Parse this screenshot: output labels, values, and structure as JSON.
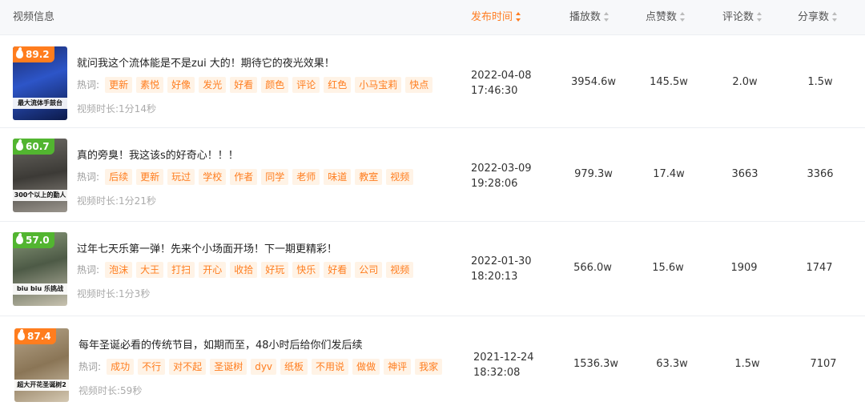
{
  "header": {
    "video_info": "视频信息",
    "publish_time": "发布时间",
    "plays": "播放数",
    "likes": "点赞数",
    "comments": "评论数",
    "shares": "分享数"
  },
  "labels": {
    "hot_words": "热词:",
    "duration_prefix": "视频时长:"
  },
  "colors": {
    "accent": "#ff7d1e",
    "score_orange": "#ff7d1e",
    "score_green": "#52b530",
    "tag_bg": "#fff3e6"
  },
  "rows": [
    {
      "score": "89.2",
      "score_color": "orange",
      "thumb_caption": "最大流体手鼓台",
      "title": "就问我这个流体能是不是zui 大的！期待它的夜光效果！",
      "tags": [
        "更新",
        "素悦",
        "好像",
        "发光",
        "好看",
        "颜色",
        "评论",
        "红色",
        "小马宝莉",
        "快点"
      ],
      "duration": "1分14秒",
      "date": "2022-04-08",
      "time": "17:46:30",
      "plays": "3954.6w",
      "likes": "145.5w",
      "comments": "2.0w",
      "shares": "1.5w"
    },
    {
      "score": "60.7",
      "score_color": "green",
      "thumb_caption": "300个以上的勤人",
      "title": "真的旁臭！我这该s的好奇心！！！",
      "tags": [
        "后续",
        "更新",
        "玩过",
        "学校",
        "作者",
        "同学",
        "老师",
        "味道",
        "教室",
        "视频"
      ],
      "duration": "1分21秒",
      "date": "2022-03-09",
      "time": "19:28:06",
      "plays": "979.3w",
      "likes": "17.4w",
      "comments": "3663",
      "shares": "3366"
    },
    {
      "score": "57.0",
      "score_color": "green",
      "thumb_caption": "biu biu 乐挑战",
      "title": "过年七天乐第一弹！先来个小场面开场！下一期更精彩！",
      "tags": [
        "泡沫",
        "大王",
        "打扫",
        "开心",
        "收拾",
        "好玩",
        "快乐",
        "好看",
        "公司",
        "视频"
      ],
      "duration": "1分3秒",
      "date": "2022-01-30",
      "time": "18:20:13",
      "plays": "566.0w",
      "likes": "15.6w",
      "comments": "1909",
      "shares": "1747"
    },
    {
      "score": "87.4",
      "score_color": "orange",
      "thumb_caption": "超大开花圣诞树2",
      "title": "每年圣诞必看的传统节目，如期而至，48小时后给你们发后续",
      "tags": [
        "成功",
        "不行",
        "对不起",
        "圣诞树",
        "dyv",
        "纸板",
        "不用说",
        "做做",
        "神评",
        "我家"
      ],
      "duration": "59秒",
      "date": "2021-12-24",
      "time": "18:32:08",
      "plays": "1536.3w",
      "likes": "63.3w",
      "comments": "1.5w",
      "shares": "7107"
    }
  ]
}
